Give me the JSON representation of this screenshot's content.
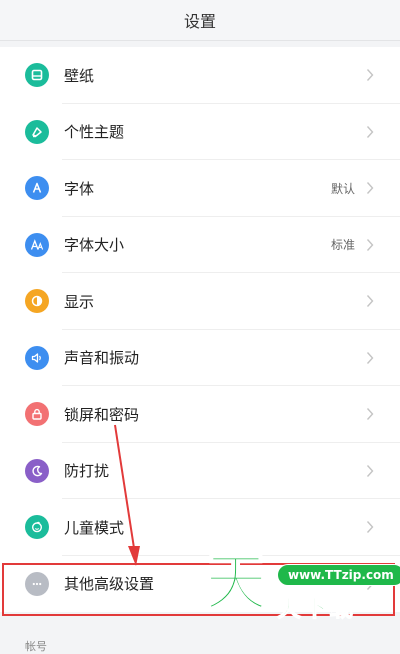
{
  "header": {
    "title": "设置"
  },
  "colors": {
    "teal": "#1bbc9b",
    "blue": "#3d8ef0",
    "orange": "#f5a623",
    "purple": "#8a5fc8",
    "gray": "#b8bcc4",
    "highlight_red": "#e23a3a",
    "watermark_green": "#1fb84a"
  },
  "settings": {
    "items": [
      {
        "label": "壁纸",
        "icon": "wallpaper-icon",
        "color": "#1bbc9b"
      },
      {
        "label": "个性主题",
        "icon": "theme-icon",
        "color": "#1bbc9b"
      },
      {
        "label": "字体",
        "icon": "font-icon",
        "color": "#3d8ef0",
        "value": "默认"
      },
      {
        "label": "字体大小",
        "icon": "font-size-icon",
        "color": "#3d8ef0",
        "value": "标准"
      },
      {
        "label": "显示",
        "icon": "display-icon",
        "color": "#f5a623"
      },
      {
        "label": "声音和振动",
        "icon": "speaker-icon",
        "color": "#3d8ef0"
      },
      {
        "label": "锁屏和密码",
        "icon": "lock-icon",
        "color": "#f27173"
      },
      {
        "label": "防打扰",
        "icon": "moon-icon",
        "color": "#8a5fc8"
      },
      {
        "label": "儿童模式",
        "icon": "child-mode-icon",
        "color": "#1bbc9b"
      },
      {
        "label": "其他高级设置",
        "icon": "more-icon",
        "color": "#b8bcc4"
      }
    ]
  },
  "section_next": {
    "label": "帐号"
  },
  "watermark": {
    "big_char": "天",
    "url": "www.TTzip.com",
    "text": "天下载"
  }
}
